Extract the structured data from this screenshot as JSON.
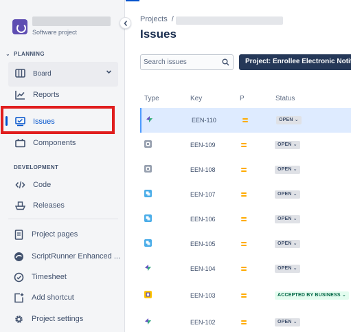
{
  "sidebar": {
    "project_type": "Software project",
    "sections": {
      "planning": "PLANNING",
      "development": "DEVELOPMENT"
    },
    "planning_items": [
      {
        "label": "Board",
        "icon": "board-icon"
      },
      {
        "label": "Reports",
        "icon": "reports-icon"
      },
      {
        "label": "Issues",
        "icon": "issues-icon"
      },
      {
        "label": "Components",
        "icon": "components-icon"
      }
    ],
    "development_items": [
      {
        "label": "Code",
        "icon": "code-icon"
      },
      {
        "label": "Releases",
        "icon": "releases-icon"
      }
    ],
    "bottom_items": [
      {
        "label": "Project pages",
        "icon": "document-icon"
      },
      {
        "label": "ScriptRunner Enhanced ...",
        "icon": "scriptrunner-icon"
      },
      {
        "label": "Timesheet",
        "icon": "clock-icon"
      },
      {
        "label": "Add shortcut",
        "icon": "add-shortcut-icon"
      },
      {
        "label": "Project settings",
        "icon": "gear-icon"
      }
    ]
  },
  "header": {
    "breadcrumb_root": "Projects",
    "breadcrumb_sep": "/",
    "title": "Issues"
  },
  "toolbar": {
    "search_placeholder": "Search issues",
    "project_filter": "Project: Enrollee Electronic Notif"
  },
  "table": {
    "columns": {
      "type": "Type",
      "key": "Key",
      "priority": "P",
      "status": "Status"
    },
    "rows": [
      {
        "type": "epic",
        "key": "EEN-110",
        "status": "OPEN ⌄"
      },
      {
        "type": "subtask",
        "key": "EEN-109",
        "status": "OPEN ⌄"
      },
      {
        "type": "subtask",
        "key": "EEN-108",
        "status": "OPEN ⌄"
      },
      {
        "type": "story",
        "key": "EEN-107",
        "status": "OPEN ⌄"
      },
      {
        "type": "story",
        "key": "EEN-106",
        "status": "OPEN ⌄"
      },
      {
        "type": "story",
        "key": "EEN-105",
        "status": "OPEN ⌄"
      },
      {
        "type": "epic",
        "key": "EEN-104",
        "status": "OPEN ⌄"
      },
      {
        "type": "custom",
        "key": "EEN-103",
        "status": "ACCEPTED BY BUSINESS ⌄"
      },
      {
        "type": "epic",
        "key": "EEN-102",
        "status": "OPEN ⌄"
      }
    ]
  },
  "colors": {
    "accent": "#0052cc",
    "highlight": "#e01e1e",
    "priority_medium": "#ffab00",
    "filter_bg": "#253858"
  }
}
